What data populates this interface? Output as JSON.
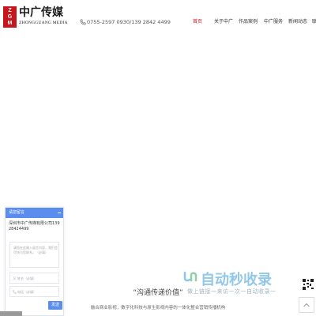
{
  "header": {
    "logo_letters": [
      "Z",
      "G",
      "M"
    ],
    "logo_cn": "中广传媒",
    "logo_en": "ZHONGGUANG MEDIA",
    "phone": "0755-2597 0930/139 2842 4499",
    "nav": [
      {
        "label": "首页",
        "active": true
      },
      {
        "label": "关于中广",
        "active": false
      },
      {
        "label": "作品案例",
        "active": false
      },
      {
        "label": "中广服务",
        "active": false
      },
      {
        "label": "新闻动态",
        "active": false
      },
      {
        "label": "联",
        "active": false
      }
    ]
  },
  "main": {
    "slogan": "“沟通传递价值”",
    "subline": "融合商业影视，数字化科技与原生影视内容的一体化整合营销传播机构"
  },
  "watermark": {
    "title": "自动秒收录",
    "sub": "做上链接一来访一次一自动收录一"
  },
  "widget": {
    "title": "请您留言",
    "company": "深圳市中广传媒有限公司13928424499",
    "message_placeholder": "请您在此输入留言内容，我们会尽快与您联系。（必填）",
    "name_placeholder": "姓名（必填）",
    "phone_placeholder": "电话（必填）",
    "send_label": "发送"
  },
  "colors": {
    "brand_red": "#c8161d",
    "widget_blue": "#5b8dee"
  }
}
